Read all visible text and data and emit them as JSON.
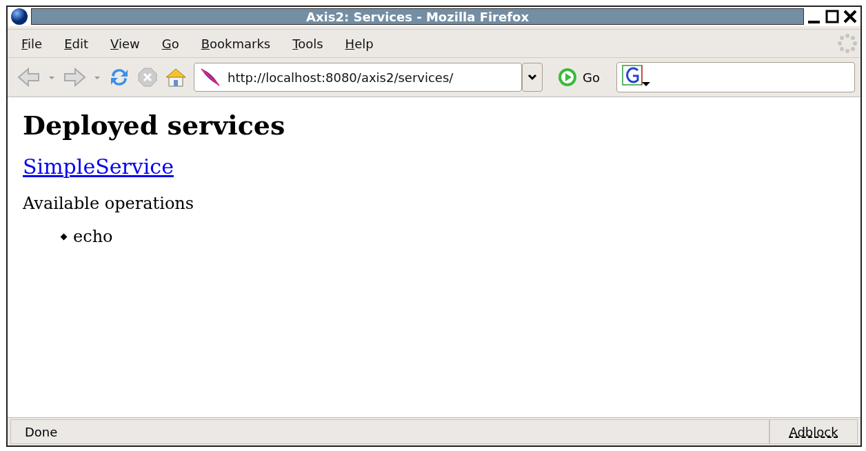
{
  "window": {
    "title": "Axis2: Services - Mozilla Firefox"
  },
  "menu": [
    {
      "label": "File"
    },
    {
      "label": "Edit"
    },
    {
      "label": "View"
    },
    {
      "label": "Go"
    },
    {
      "label": "Bookmarks"
    },
    {
      "label": "Tools"
    },
    {
      "label": "Help"
    }
  ],
  "toolbar": {
    "url": "http://localhost:8080/axis2/services/",
    "go_label": "Go"
  },
  "page": {
    "heading": "Deployed services",
    "services": [
      {
        "name": "SimpleService",
        "operations_label": "Available operations",
        "operations": [
          "echo"
        ]
      }
    ]
  },
  "status_bar": {
    "text": "Done",
    "addon": "Adblock"
  }
}
